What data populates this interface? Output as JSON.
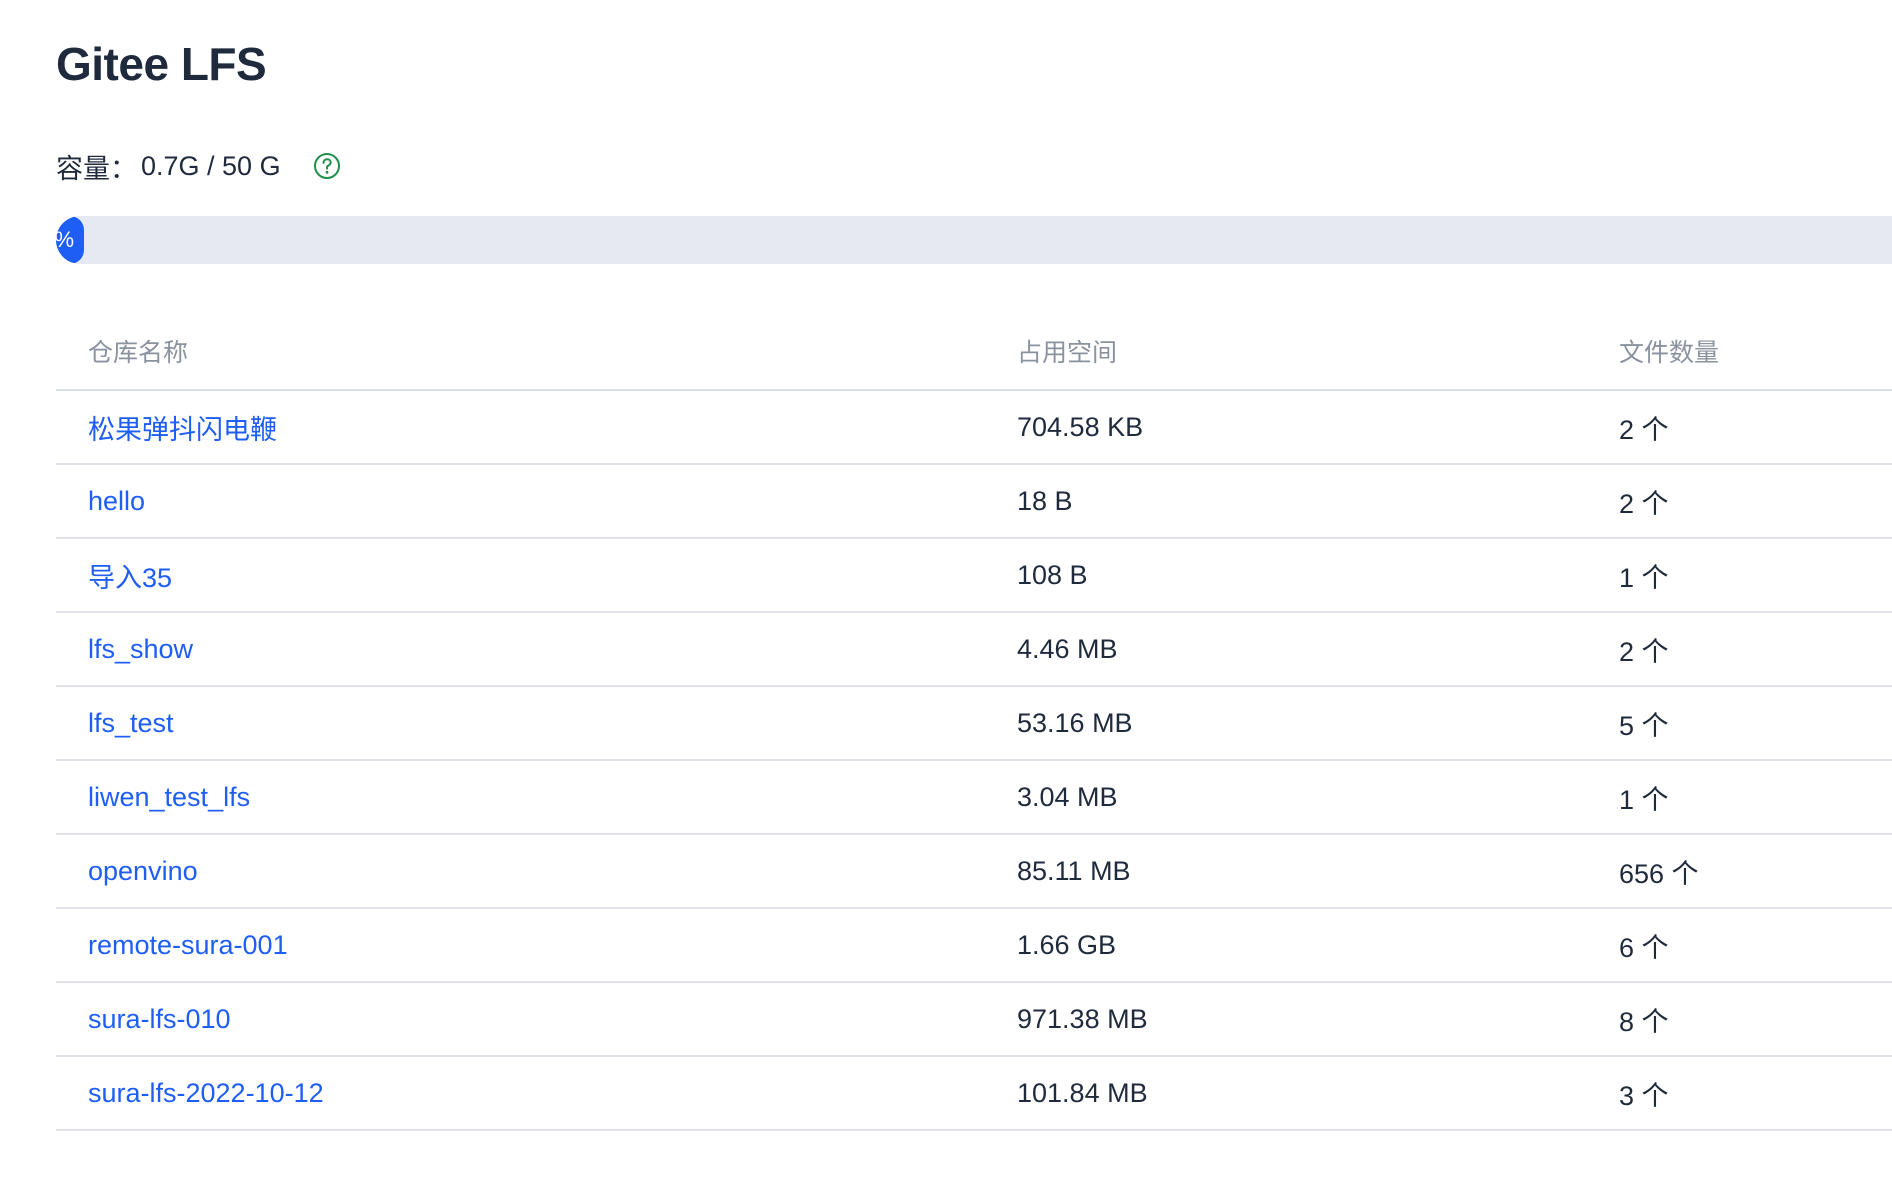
{
  "header": {
    "title": "Gitee LFS"
  },
  "capacity": {
    "label": "容量：",
    "value": "0.7G / 50 G",
    "help_icon": "question-circle-icon",
    "progress_text": "%",
    "progress_percent": 1.4,
    "accent_color": "#1e5ef5",
    "help_color": "#1f8f4a"
  },
  "table": {
    "headers": {
      "name": "仓库名称",
      "size": "占用空间",
      "count": "文件数量"
    },
    "rows": [
      {
        "name": "松果弹抖闪电鞭",
        "size": "704.58 KB",
        "count": "2 个"
      },
      {
        "name": "hello",
        "size": "18 B",
        "count": "2 个"
      },
      {
        "name": "导入35",
        "size": "108 B",
        "count": "1 个"
      },
      {
        "name": "lfs_show",
        "size": "4.46 MB",
        "count": "2 个"
      },
      {
        "name": "lfs_test",
        "size": "53.16 MB",
        "count": "5 个"
      },
      {
        "name": "liwen_test_lfs",
        "size": "3.04 MB",
        "count": "1 个"
      },
      {
        "name": "openvino",
        "size": "85.11 MB",
        "count": "656 个"
      },
      {
        "name": "remote-sura-001",
        "size": "1.66 GB",
        "count": "6 个"
      },
      {
        "name": "sura-lfs-010",
        "size": "971.38 MB",
        "count": "8 个"
      },
      {
        "name": "sura-lfs-2022-10-12",
        "size": "101.84 MB",
        "count": "3 个"
      }
    ]
  }
}
